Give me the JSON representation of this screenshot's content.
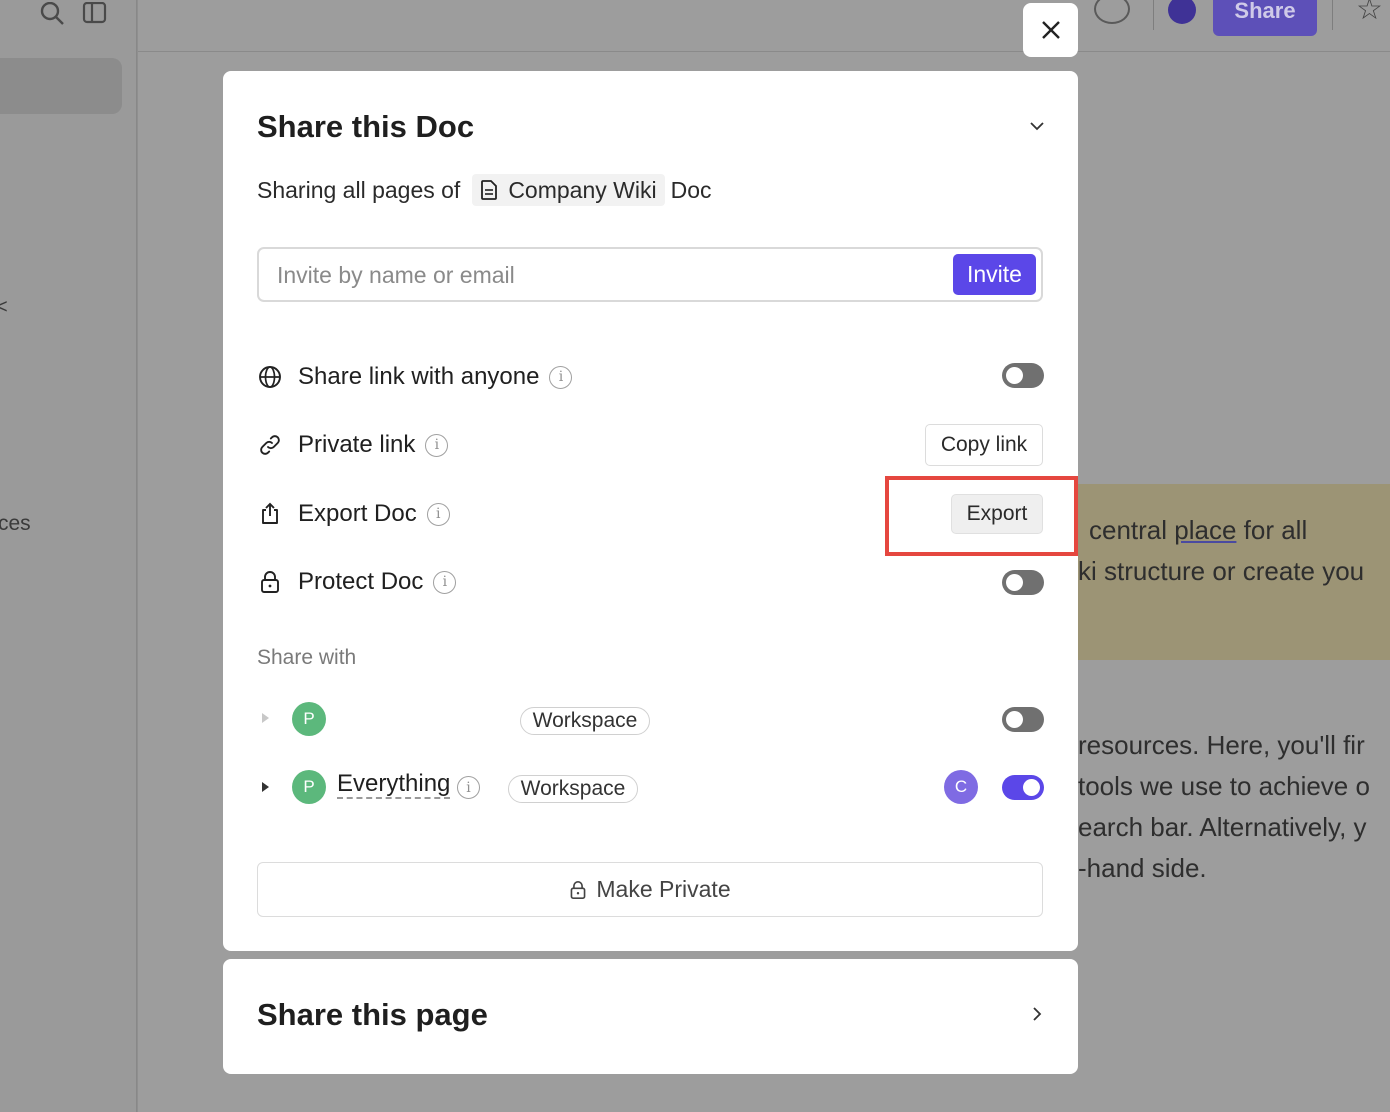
{
  "background": {
    "sidebar_fragments": [
      "<",
      "ces"
    ],
    "share_button_label": "Share",
    "content_lines": [
      {
        "pre": "central ",
        "underlined": "place",
        "post": " for all"
      },
      {
        "pre": "ki structure or create you",
        "underlined": "",
        "post": ""
      },
      {
        "pre": "resources. Here, you'll fir",
        "underlined": "",
        "post": ""
      },
      {
        "pre": "tools we use to achieve o",
        "underlined": "",
        "post": ""
      },
      {
        "pre": "earch bar. Alternatively, y",
        "underlined": "",
        "post": ""
      },
      {
        "pre": "-hand side.",
        "underlined": "",
        "post": ""
      }
    ]
  },
  "modal": {
    "title": "Share this Doc",
    "subtitle_prefix": "Sharing all pages of",
    "doc_name": "Company Wiki",
    "subtitle_suffix": "Doc",
    "invite_placeholder": "Invite by name or email",
    "invite_button": "Invite",
    "options": {
      "share_link": "Share link with anyone",
      "private_link": "Private link",
      "copy_link": "Copy link",
      "export_doc": "Export Doc",
      "export_button": "Export",
      "protect_doc": "Protect Doc"
    },
    "share_with_label": "Share with",
    "share_with": [
      {
        "avatar": "P",
        "name": "",
        "scope": "Workspace",
        "enabled": false
      },
      {
        "avatar": "P",
        "name": "Everything",
        "scope": "Workspace",
        "member_avatar": "C",
        "enabled": true
      }
    ],
    "make_private": "Make Private",
    "share_page_title": "Share this page"
  },
  "colors": {
    "accent": "#5b47e8",
    "avatar_green": "#5cb87c",
    "avatar_purple": "#7f6be3",
    "highlight_red": "#e5473f"
  },
  "icons": [
    "search-icon",
    "sidebar-toggle-icon",
    "close-icon",
    "chevron-down-icon",
    "document-icon",
    "globe-icon",
    "link-icon",
    "upload-icon",
    "lock-icon",
    "info-icon",
    "chevron-right-icon",
    "caret-right-icon",
    "star-icon"
  ]
}
